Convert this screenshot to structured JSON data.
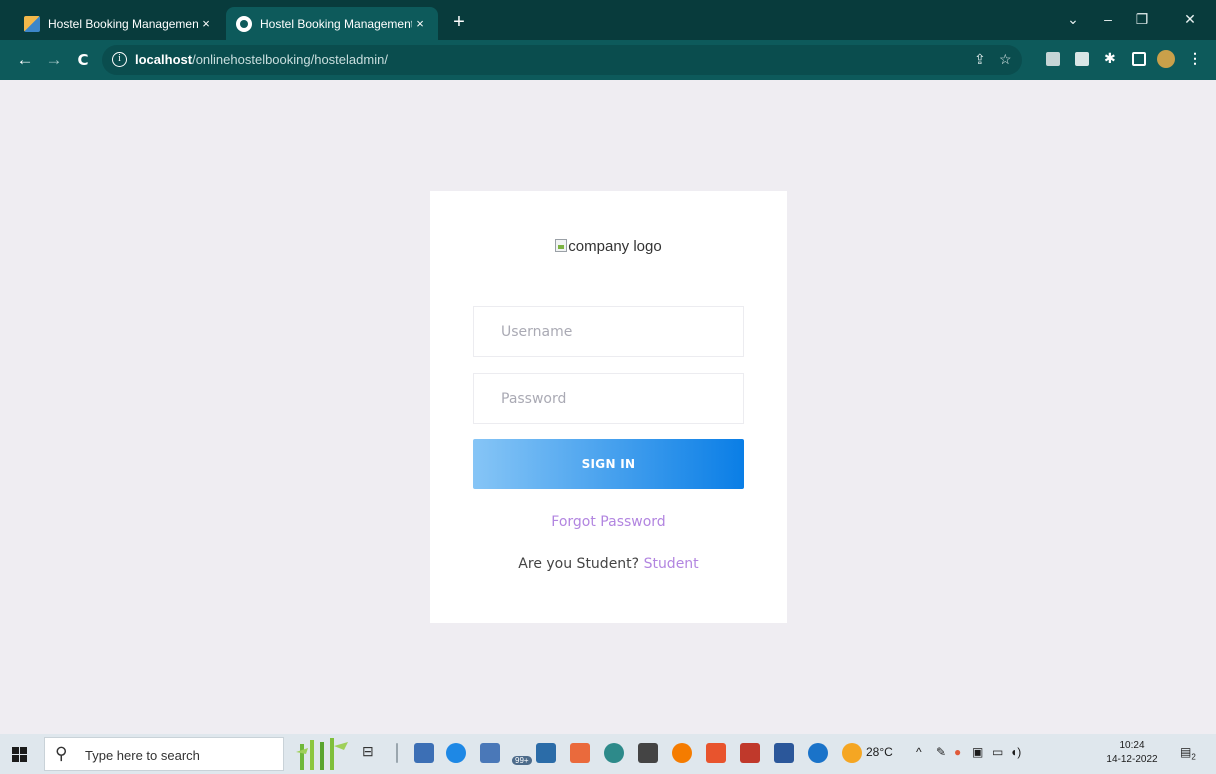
{
  "browser": {
    "tabs": [
      {
        "title": "Hostel Booking Management Sys",
        "active": false
      },
      {
        "title": "Hostel Booking Management Sys",
        "active": true
      }
    ],
    "new_tab_label": "+",
    "close_label": "×",
    "url_host": "localhost",
    "url_path": "/onlinehostelbooking/hosteladmin/",
    "window_controls": {
      "dropdown": "⌄",
      "minimize": "–",
      "restore": "❐",
      "close": "✕"
    },
    "nav": {
      "back": "←",
      "forward": "→",
      "reload": "C"
    },
    "colors": {
      "tabstrip": "#083b3c",
      "toolbar": "#0d5a5b"
    }
  },
  "login": {
    "logo_alt": "company logo",
    "username_placeholder": "Username",
    "password_placeholder": "Password",
    "signin_label": "SIGN IN",
    "forgot_label": "Forgot Password",
    "student_prompt": "Are you Student? ",
    "student_link": "Student",
    "colors": {
      "button_start": "#86c5f6",
      "button_end": "#0a7ee6",
      "link": "#b285e0",
      "background": "#efedf2"
    }
  },
  "taskbar": {
    "search_placeholder": "Type here to search",
    "badge": "99+",
    "weather": "28°C",
    "time": "10:24",
    "date": "14-12-2022",
    "notification_count": "2"
  }
}
